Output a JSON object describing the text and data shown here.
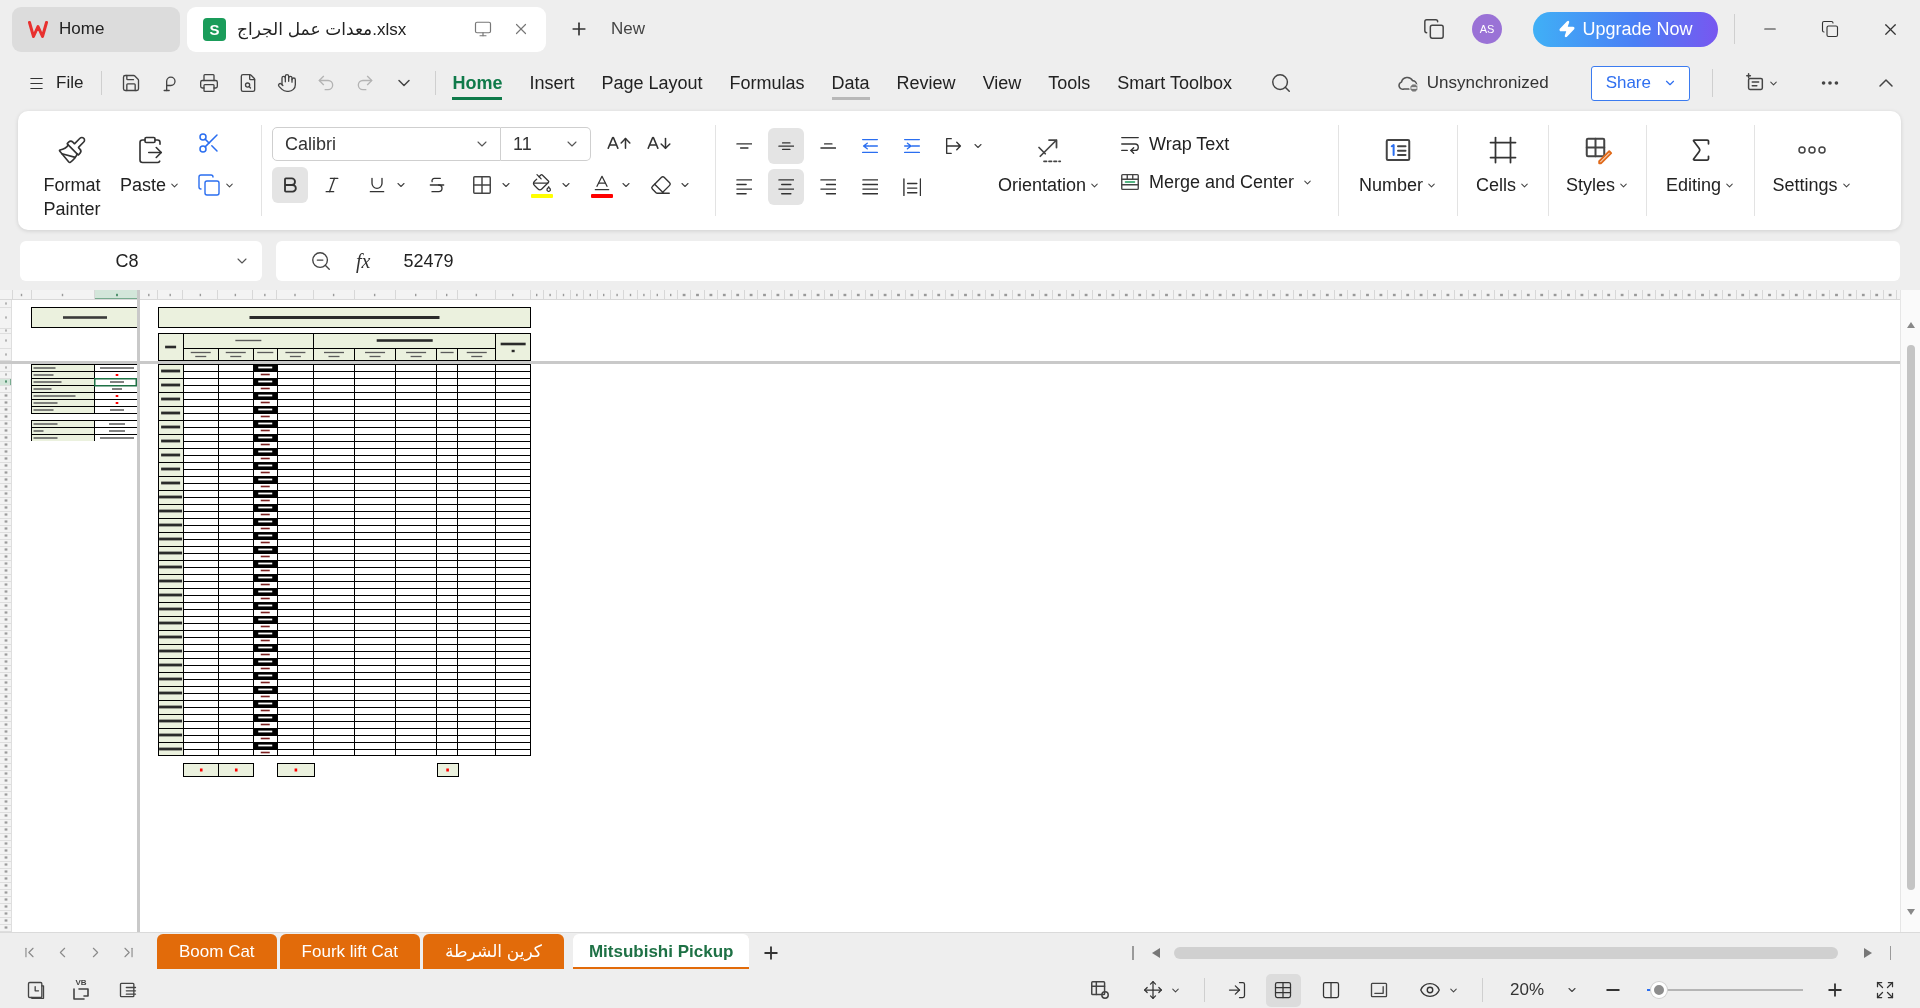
{
  "title_bar": {
    "tabs": [
      {
        "label": "Home",
        "kind": "home",
        "selected": false
      },
      {
        "label": "معدات عمل الجراج.xlsx",
        "kind": "sheet",
        "badge": "S",
        "selected": true
      }
    ],
    "new_tab": "New",
    "avatar": "AS",
    "upgrade": "Upgrade Now"
  },
  "menu": {
    "file": "File",
    "quick_access": [
      {
        "kind": "save",
        "disabled": false
      },
      {
        "kind": "hook",
        "disabled": false
      },
      {
        "kind": "print",
        "disabled": false
      },
      {
        "kind": "preview",
        "disabled": false
      },
      {
        "kind": "hand",
        "disabled": false
      },
      {
        "kind": "undo",
        "disabled": true
      },
      {
        "kind": "redo",
        "disabled": true
      },
      {
        "kind": "more",
        "disabled": false
      }
    ],
    "tabs": [
      {
        "label": "Home",
        "selected": true,
        "hovered": false
      },
      {
        "label": "Insert",
        "selected": false,
        "hovered": false
      },
      {
        "label": "Page Layout",
        "selected": false,
        "hovered": false
      },
      {
        "label": "Formulas",
        "selected": false,
        "hovered": false
      },
      {
        "label": "Data",
        "selected": false,
        "hovered": true
      },
      {
        "label": "Review",
        "selected": false,
        "hovered": false
      },
      {
        "label": "View",
        "selected": false,
        "hovered": false
      },
      {
        "label": "Tools",
        "selected": false,
        "hovered": false
      },
      {
        "label": "Smart Toolbox",
        "selected": false,
        "hovered": false
      }
    ],
    "sync_status": "Unsynchronized",
    "share": "Share"
  },
  "ribbon": {
    "format_painter": "Format Painter",
    "paste": "Paste",
    "font": "Calibri",
    "font_size": "11",
    "styles": [
      {
        "kind": "bold",
        "selected": true
      },
      {
        "kind": "italic",
        "selected": false
      },
      {
        "kind": "underline",
        "selected": false
      },
      {
        "kind": "strikethrough",
        "selected": false
      }
    ],
    "color_tools": [
      {
        "kind": "fill",
        "color": "#ffff00"
      },
      {
        "kind": "text",
        "color": "#ff0000"
      }
    ],
    "vertical_align": [
      {
        "kind": "top",
        "selected": false
      },
      {
        "kind": "middle",
        "selected": true
      },
      {
        "kind": "bottom",
        "selected": false
      }
    ],
    "horizontal_align": [
      {
        "kind": "left",
        "selected": false
      },
      {
        "kind": "center",
        "selected": true
      },
      {
        "kind": "right",
        "selected": false
      },
      {
        "kind": "justify",
        "selected": false
      },
      {
        "kind": "distributed",
        "selected": false
      }
    ],
    "orientation": "Orientation",
    "wrap_text": "Wrap Text",
    "merge": "Merge and Center",
    "groups": [
      {
        "label": "Number",
        "kind": "number"
      },
      {
        "label": "Cells",
        "kind": "cells"
      },
      {
        "label": "Styles",
        "kind": "styles"
      },
      {
        "label": "Editing",
        "kind": "editing"
      },
      {
        "label": "Settings",
        "kind": "settings"
      }
    ]
  },
  "formula_bar": {
    "cell": "C8",
    "function_label": "fx",
    "value": "52479"
  },
  "sheet_tabs": [
    {
      "label": "Boom Cat",
      "selected": false
    },
    {
      "label": "Fourk lift Cat",
      "selected": false
    },
    {
      "label": "كرين الشرطة",
      "selected": false
    },
    {
      "label": "Mitsubishi Pickup",
      "selected": true
    }
  ],
  "status_bar": {
    "macro_badge": "VB",
    "views": [
      {
        "kind": "normal",
        "selected": true
      },
      {
        "kind": "page_break",
        "selected": false
      },
      {
        "kind": "page_layout",
        "selected": false
      }
    ],
    "zoom": "20%",
    "zoom_slider": {
      "level": 0.08
    }
  }
}
